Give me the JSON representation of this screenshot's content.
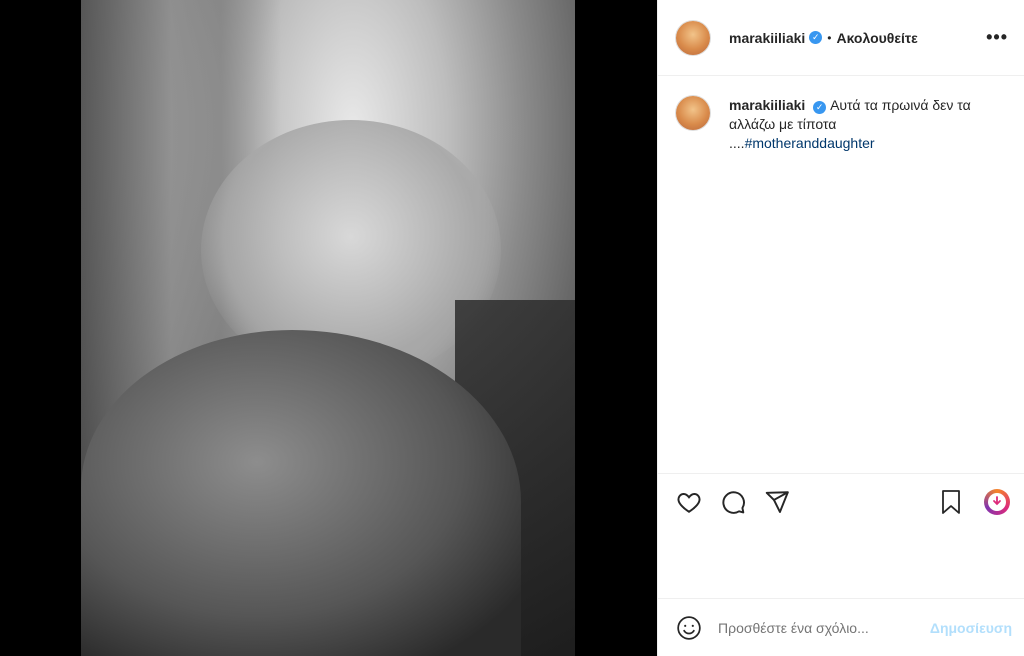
{
  "post": {
    "username": "marakiiliaki",
    "verified_mark": "✓",
    "follow_separator": "•",
    "follow_status": "Ακολουθείτε",
    "more_options": "•••",
    "caption": {
      "username": "marakiiliaki",
      "verified_mark": "✓",
      "text": "Αυτά τα πρωινά δεν τα αλλάζω με τίποτα ....",
      "hashtag": "#motheranddaughter"
    }
  },
  "actions": {
    "icons": [
      "heart-icon",
      "comment-icon",
      "share-icon",
      "bookmark-icon",
      "igtv-icon"
    ]
  },
  "comment_box": {
    "placeholder": "Προσθέστε ένα σχόλιο...",
    "post_label": "Δημοσίευση"
  },
  "colors": {
    "link": "#00376b",
    "verified": "#3897f0",
    "post_disabled": "#b2dffc",
    "text": "#262626",
    "muted": "#8e8e8e"
  }
}
